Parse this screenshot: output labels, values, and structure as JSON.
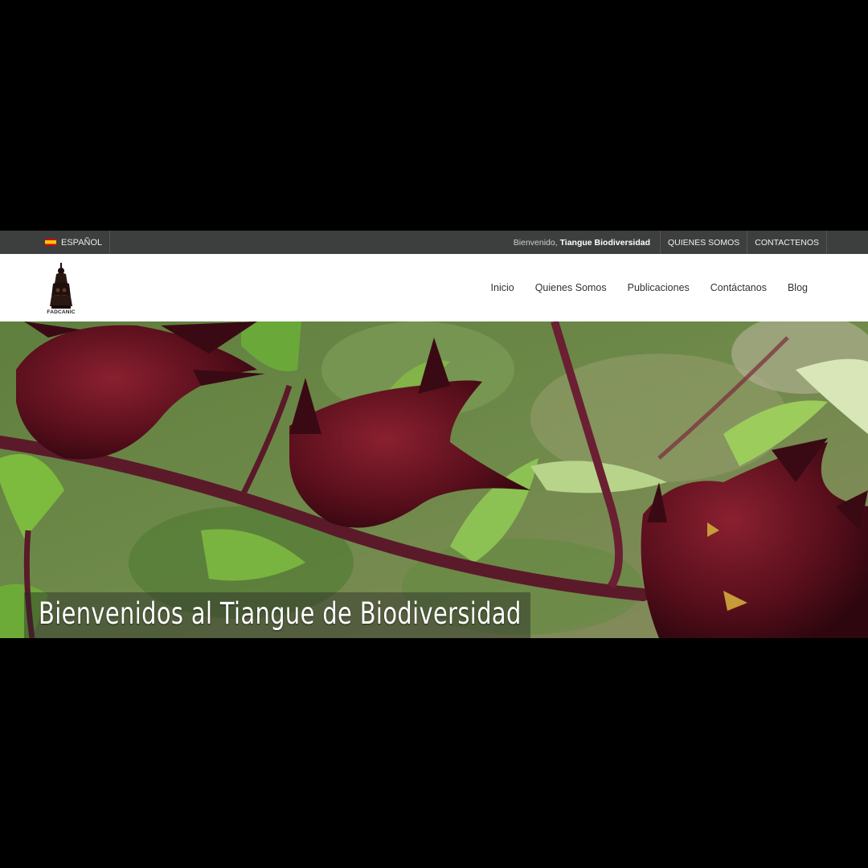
{
  "topbar": {
    "language": "ESPAÑOL",
    "welcome_prefix": "Bienvenido,",
    "welcome_user": "Tiangue Biodiversidad",
    "links": [
      "QUIENES SOMOS",
      "CONTACTENOS"
    ]
  },
  "header": {
    "logo_text": "FADCANIC",
    "nav": [
      "Inicio",
      "Quienes Somos",
      "Publicaciones",
      "Contáctanos",
      "Blog"
    ]
  },
  "hero": {
    "title": "Bienvenidos al Tiangue de Biodiversidad"
  },
  "colors": {
    "topbar_bg": "#3d3f3e",
    "header_bg": "#ffffff",
    "letterbox": "#000000"
  }
}
